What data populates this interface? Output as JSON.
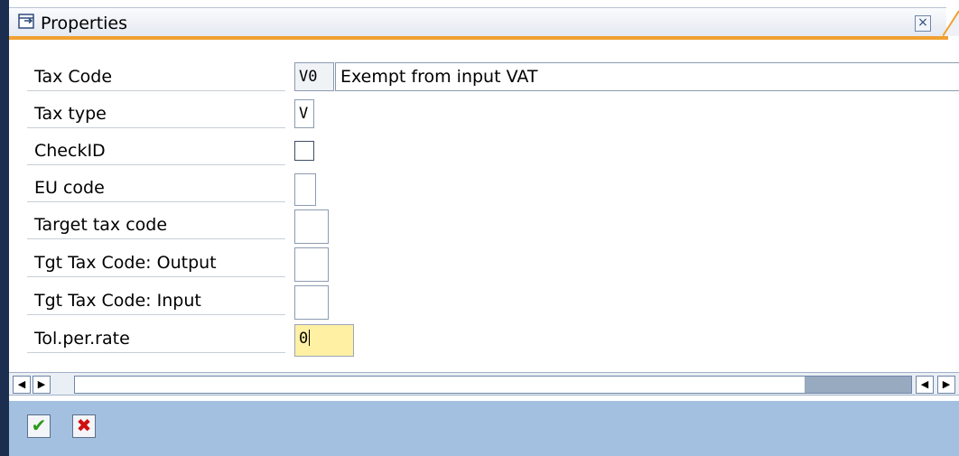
{
  "window": {
    "title": "Properties",
    "close_glyph": "×"
  },
  "properties": {
    "tax_code": {
      "label": "Tax Code",
      "value": "V0",
      "description": "Exempt from input VAT"
    },
    "tax_type": {
      "label": "Tax type",
      "value": "V"
    },
    "check_id": {
      "label": "CheckID",
      "checked": false
    },
    "eu_code": {
      "label": "EU code",
      "value": ""
    },
    "target_tax_code": {
      "label": "Target tax code",
      "value": ""
    },
    "tgt_tax_code_output": {
      "label": "Tgt Tax Code: Output",
      "value": ""
    },
    "tgt_tax_code_input": {
      "label": "Tgt Tax Code: Input",
      "value": ""
    },
    "tol_per_rate": {
      "label": "Tol.per.rate",
      "value": "0"
    }
  },
  "scrollbar": {
    "left_arrow": "◀",
    "right_arrow": "▶",
    "position_fraction": 1.0
  },
  "footer": {
    "ok_glyph": "✔",
    "cancel_glyph": "✖"
  },
  "colors": {
    "title_accent": "#f0a030",
    "footer_bg": "#a3c0e0",
    "active_field_bg": "#fff0a3",
    "ok_green": "#2a9a1a",
    "cancel_red": "#d01010"
  },
  "icons": {
    "title": "window-icon",
    "close": "close-icon",
    "ok": "checkmark-icon",
    "cancel": "cancel-icon"
  }
}
